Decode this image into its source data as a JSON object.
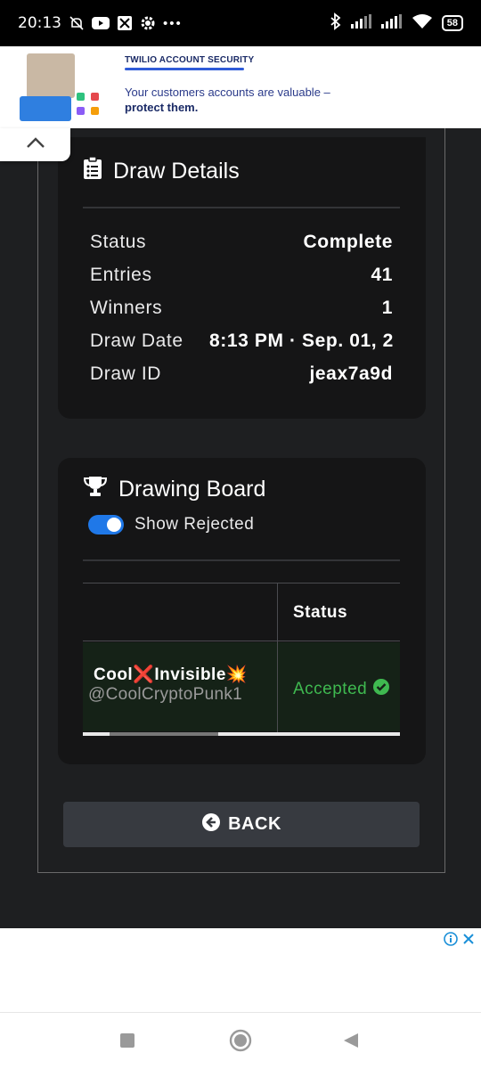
{
  "status_bar": {
    "time": "20:13",
    "battery": "58",
    "icons": [
      "mute-icon",
      "youtube-icon",
      "app-icon",
      "settings-icon",
      "more-icon",
      "bluetooth-icon",
      "signal-icon",
      "signal-icon-2",
      "wifi-icon"
    ]
  },
  "ad_top": {
    "headline": "TWILIO ACCOUNT SECURITY",
    "line1": "Your customers accounts are valuable –",
    "line2": "protect them."
  },
  "draw_details": {
    "title": "Draw Details",
    "rows": [
      {
        "label": "Status",
        "value": "Complete"
      },
      {
        "label": "Entries",
        "value": "41"
      },
      {
        "label": "Winners",
        "value": "1"
      },
      {
        "label": "Draw Date",
        "value": "8:13 PM · Sep. 01, 2"
      },
      {
        "label": "Draw ID",
        "value": "jeax7a9d"
      }
    ]
  },
  "drawing_board": {
    "title": "Drawing Board",
    "toggle_label": "Show Rejected",
    "toggle_on": true,
    "columns": [
      "",
      "Status"
    ],
    "rows": [
      {
        "name": "Cool❌Invisible💥",
        "handle": "@CoolCryptoPunk1",
        "status": "Accepted"
      }
    ]
  },
  "back_button": {
    "label": "BACK"
  },
  "colors": {
    "background": "#1e1f21",
    "card": "#151516",
    "accent_blue": "#1f78e8",
    "accepted_green": "#3fb950"
  }
}
